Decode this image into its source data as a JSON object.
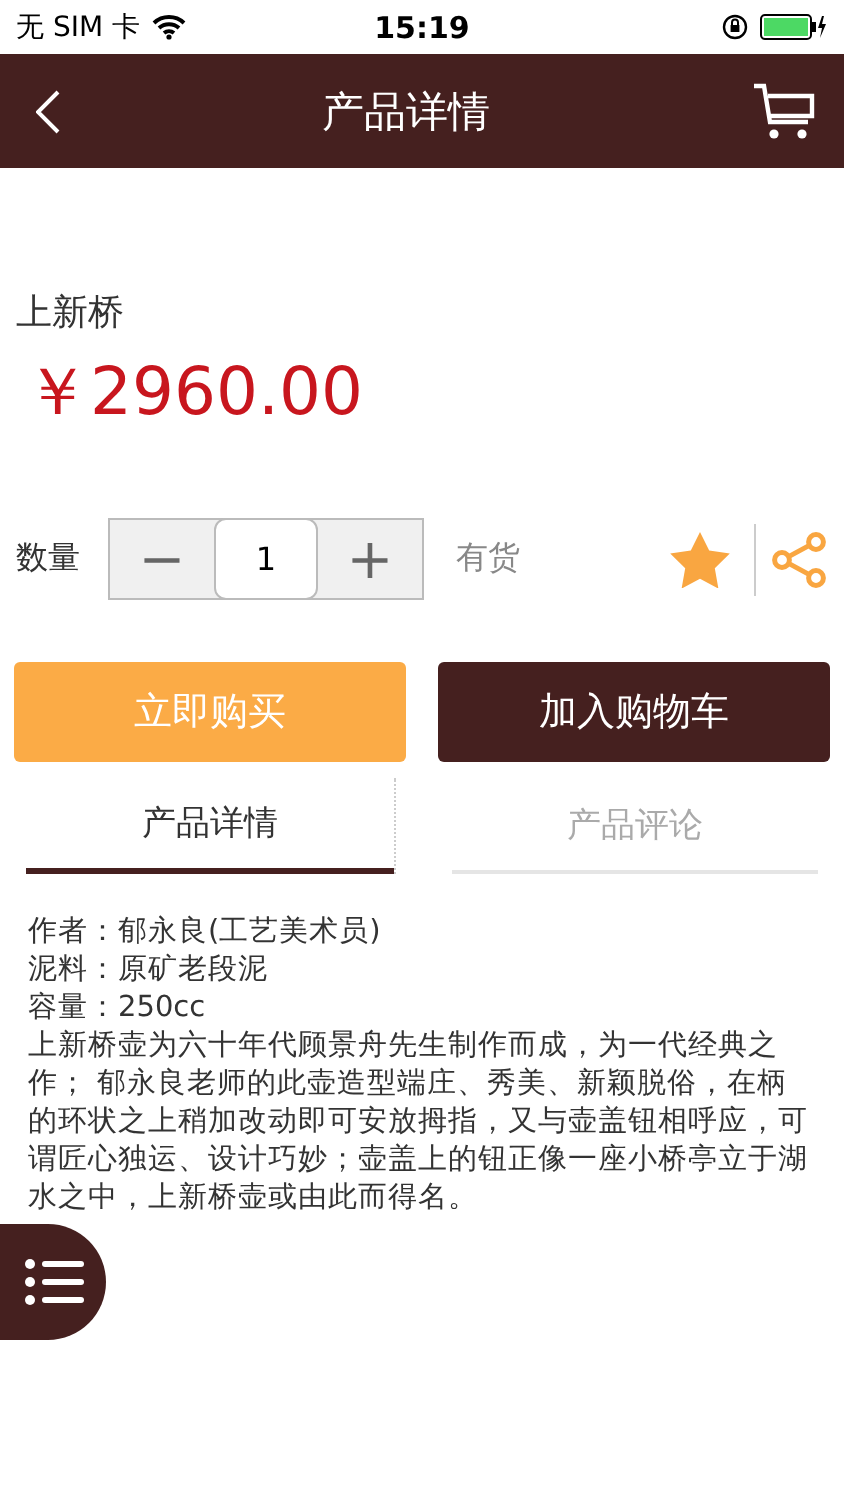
{
  "status_bar": {
    "carrier": "无 SIM 卡",
    "time": "15:19"
  },
  "nav": {
    "title": "产品详情"
  },
  "product": {
    "name": "上新桥",
    "price": "￥2960.00"
  },
  "quantity": {
    "label": "数量",
    "minus": "−",
    "value": "1",
    "plus": "+",
    "stock": "有货"
  },
  "buttons": [
    {
      "label": "立即购买",
      "kind": "primary"
    },
    {
      "label": "加入购物车",
      "kind": "secondary"
    }
  ],
  "tabs": [
    {
      "label": "产品详情",
      "selected": true
    },
    {
      "label": "产品评论",
      "selected": false
    }
  ],
  "details": [
    "作者：郁永良(工艺美术员)",
    "泥料：原矿老段泥",
    "容量：250cc",
    "上新桥壶为六十年代顾景舟先生制作而成，为一代经典之作； 郁永良老师的此壶造型端庄、秀美、新颖脱俗，在柄的环状之上稍加改动即可安放拇指，又与壶盖钮相呼应，可谓匠心独运、设计巧妙；壶盖上的钮正像一座小桥亭立于湖水之中，上新桥壶或由此而得名。"
  ]
}
